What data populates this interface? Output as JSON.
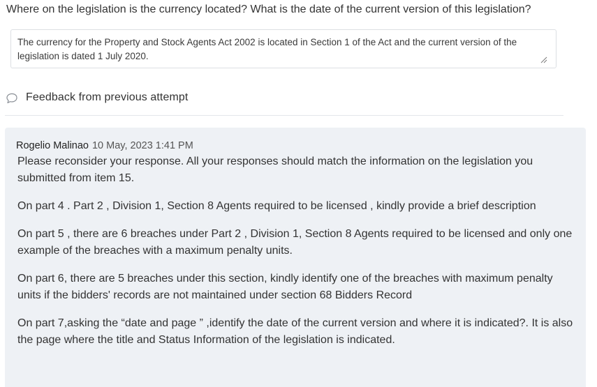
{
  "question": {
    "text": "Where on the legislation is the currency located? What is the date of the current version of this legislation?"
  },
  "answer": {
    "value": "The currency for the Property and Stock Agents Act 2002 is located in Section 1 of the Act and the current version of the legislation is dated 1 July 2020."
  },
  "feedback": {
    "icon": "speech-bubble-icon",
    "title": "Feedback from previous attempt",
    "author": "Rogelio Malinao",
    "timestamp": "10 May, 2023 1:41 PM",
    "messages": [
      "Please reconsider your response. All your responses should match the information on the legislation you submitted from item 15.",
      "On part 4 . Part 2 , Division 1, Section 8 Agents required to be licensed , kindly provide a brief description",
      "On part 5 , there are 6 breaches under Part 2 , Division 1, Section 8 Agents required to be licensed and only one example of the breaches with a maximum penalty units.",
      "On part 6, there are 5 breaches under this section, kindly identify one of the breaches with maximum penalty units if the bidders' records are not maintained under section 68 Bidders Record",
      "On part 7,asking the “date and page ” ,identify the date of the current version and where it is indicated?. It is also the page where the title and Status Information of the legislation is indicated."
    ]
  },
  "colors": {
    "panel_background": "#eef1f5",
    "border": "#dcdfe3",
    "text": "#333333"
  }
}
